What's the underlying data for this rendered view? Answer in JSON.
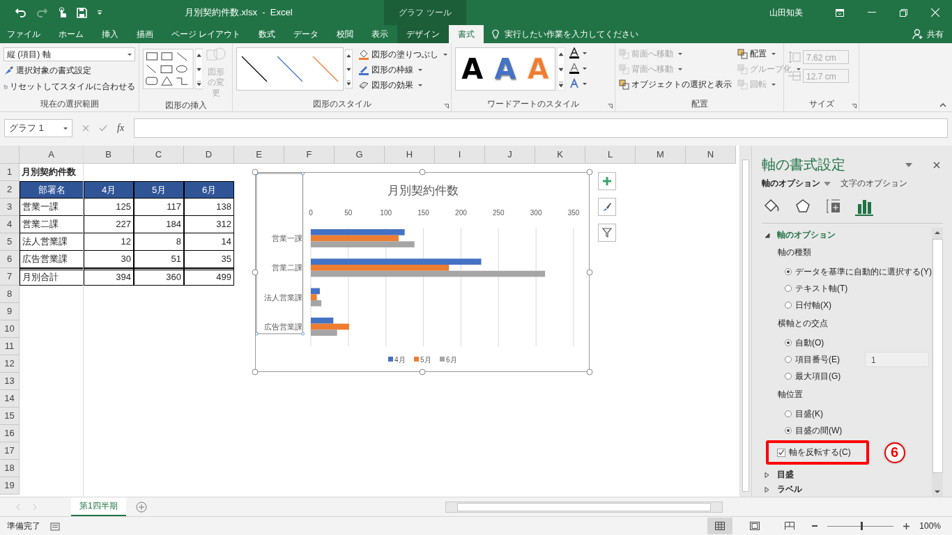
{
  "window": {
    "title": "月別契約件数.xlsx  -  Excel",
    "contextual_group": "グラフ ツール",
    "user": "山田知美"
  },
  "ribbon_tabs": [
    {
      "label": "ファイル",
      "kind": "standard",
      "selected": false
    },
    {
      "label": "ホーム",
      "kind": "standard",
      "selected": false
    },
    {
      "label": "挿入",
      "kind": "standard",
      "selected": false
    },
    {
      "label": "描画",
      "kind": "standard",
      "selected": false
    },
    {
      "label": "ページ レイアウト",
      "kind": "standard",
      "selected": false
    },
    {
      "label": "数式",
      "kind": "standard",
      "selected": false
    },
    {
      "label": "データ",
      "kind": "standard",
      "selected": false
    },
    {
      "label": "校閲",
      "kind": "standard",
      "selected": false
    },
    {
      "label": "表示",
      "kind": "standard",
      "selected": false
    },
    {
      "label": "デザイン",
      "kind": "contextual",
      "selected": false
    },
    {
      "label": "書式",
      "kind": "contextual",
      "selected": true
    }
  ],
  "tell_me": {
    "placeholder": "実行したい作業を入力してください"
  },
  "share": "共有",
  "ribbon": {
    "current_selection": {
      "label": "現在の選択範囲",
      "element": "縦 (項目) 軸",
      "buttons": [
        "選択対象の書式設定",
        "リセットしてスタイルに合わせる"
      ]
    },
    "insert_shapes": {
      "label": "図形の挿入",
      "change_shape": {
        "label": "図形の変更",
        "disabled": true
      }
    },
    "shape_styles": {
      "label": "図形のスタイル",
      "presets": [
        {
          "color": "#000000"
        },
        {
          "color": "#4472c4"
        },
        {
          "color": "#ed7d31"
        }
      ],
      "buttons": [
        "図形の塗りつぶし",
        "図形の枠線",
        "図形の効果"
      ]
    },
    "wordart_styles": {
      "label": "ワードアートのスタイル",
      "samples": [
        {
          "text": "A",
          "kind": "solid",
          "color": "#000000"
        },
        {
          "text": "A",
          "kind": "shadow",
          "color": "#4472c4"
        },
        {
          "text": "A",
          "kind": "outline",
          "color": "#ed7d31"
        }
      ]
    },
    "arrange": {
      "label": "配置",
      "buttons": [
        {
          "label": "前面へ移動",
          "disabled": true
        },
        {
          "label": "背面へ移動",
          "disabled": true
        },
        {
          "label": "オブジェクトの選択と表示",
          "disabled": false
        },
        {
          "label": "配置",
          "disabled": false
        },
        {
          "label": "グループ化",
          "disabled": true
        },
        {
          "label": "回転",
          "disabled": true
        }
      ]
    },
    "size": {
      "label": "サイズ",
      "height": "7.62 cm",
      "width": "12.7 cm",
      "disabled": true
    }
  },
  "formula_bar": {
    "name_box": "グラフ 1",
    "fx": "fx"
  },
  "sheet": {
    "columns": [
      "A",
      "B",
      "C",
      "D",
      "E",
      "F",
      "G",
      "H",
      "I",
      "J",
      "K",
      "L",
      "M",
      "N"
    ],
    "rows": [
      {
        "number": "1",
        "kind": "title",
        "cells": [
          "月別契約件数"
        ]
      },
      {
        "number": "2",
        "kind": "header",
        "cells": [
          "部署名",
          "4月",
          "5月",
          "6月"
        ]
      },
      {
        "number": "3",
        "kind": "data",
        "cells": [
          "営業一課",
          "125",
          "117",
          "138"
        ]
      },
      {
        "number": "4",
        "kind": "data",
        "cells": [
          "営業二課",
          "227",
          "184",
          "312"
        ]
      },
      {
        "number": "5",
        "kind": "data",
        "cells": [
          "法人営業課",
          "12",
          "8",
          "14"
        ]
      },
      {
        "number": "6",
        "kind": "data",
        "cells": [
          "広告営業課",
          "30",
          "51",
          "35"
        ]
      },
      {
        "number": "7",
        "kind": "total",
        "cells": [
          "月別合計",
          "394",
          "360",
          "499"
        ]
      },
      {
        "number": "8"
      },
      {
        "number": "9"
      },
      {
        "number": "10"
      },
      {
        "number": "11"
      },
      {
        "number": "12"
      },
      {
        "number": "13"
      },
      {
        "number": "14"
      },
      {
        "number": "15"
      },
      {
        "number": "16"
      },
      {
        "number": "17"
      },
      {
        "number": "18"
      },
      {
        "number": "19"
      }
    ]
  },
  "chart": {
    "chart_data": {
      "type": "bar",
      "orientation": "horizontal",
      "title": "月別契約件数",
      "categories": [
        "営業一課",
        "営業二課",
        "法人営業課",
        "広告営業課"
      ],
      "series": [
        {
          "name": "4月",
          "color": "#4472c4",
          "values": [
            125,
            227,
            12,
            30
          ]
        },
        {
          "name": "5月",
          "color": "#ed7d31",
          "values": [
            117,
            184,
            8,
            51
          ]
        },
        {
          "name": "6月",
          "color": "#a5a5a5",
          "values": [
            138,
            312,
            14,
            35
          ]
        }
      ],
      "xlim": [
        0,
        350
      ],
      "xticks": [
        0,
        50,
        100,
        150,
        200,
        250,
        300,
        350
      ],
      "grid": true,
      "legend": true
    }
  },
  "format_pane": {
    "title": "軸の書式設定",
    "tabs": [
      {
        "label": "軸のオプション",
        "selected": true
      },
      {
        "label": "文字のオプション",
        "selected": false
      }
    ],
    "icon_tabs": [
      {
        "kind": "fill",
        "selected": false
      },
      {
        "kind": "effects",
        "selected": false
      },
      {
        "kind": "size",
        "selected": false
      },
      {
        "kind": "options",
        "selected": true
      }
    ],
    "section": {
      "title": "軸のオプション",
      "expanded": true
    },
    "groups": [
      {
        "heading": "軸の種類",
        "options": [
          {
            "label": "データを基準に自動的に選択する(Y)",
            "selected": true
          },
          {
            "label": "テキスト軸(T)",
            "selected": false
          },
          {
            "label": "日付軸(X)",
            "selected": false
          }
        ]
      },
      {
        "heading": "横軸との交点",
        "options": [
          {
            "label": "自動(O)",
            "selected": true
          },
          {
            "label": "項目番号(E)",
            "selected": false,
            "value": "1"
          },
          {
            "label": "最大項目(G)",
            "selected": false
          }
        ]
      },
      {
        "heading": "軸位置",
        "options": [
          {
            "label": "目盛(K)",
            "selected": false
          },
          {
            "label": "目盛の間(W)",
            "selected": true
          }
        ]
      }
    ],
    "reverse": {
      "label": "軸を反転する(C)",
      "checked": true,
      "highlighted": true
    },
    "step_badge": "6",
    "collapsed_sections": [
      {
        "title": "目盛",
        "expanded": false
      },
      {
        "title": "ラベル",
        "expanded": false
      }
    ]
  },
  "sheet_tabs": [
    {
      "label": "第1四半期",
      "selected": true
    }
  ],
  "status_bar": {
    "status": "準備完了",
    "zoom": {
      "reading": "100%",
      "level": 0.5
    }
  }
}
